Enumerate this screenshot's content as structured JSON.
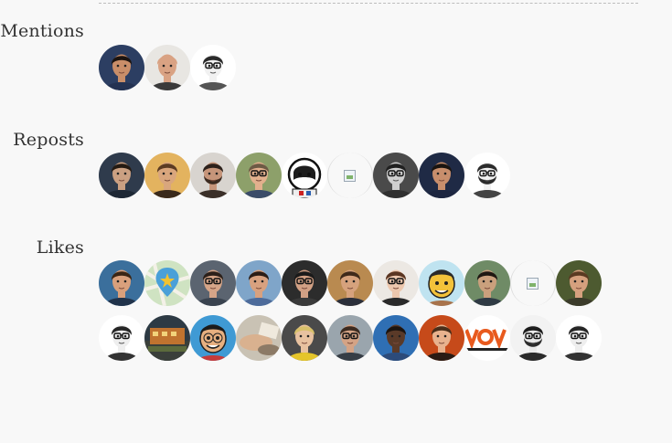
{
  "sections": {
    "mentions": {
      "label": "Mentions",
      "avatars": [
        {
          "icon": "person-avatar",
          "bg": "#2c3e62",
          "skin": "#c98e69",
          "hair": "#1c1410",
          "shirt": "#243252"
        },
        {
          "icon": "person-avatar",
          "bg": "#e8e6e2",
          "skin": "#d9a283",
          "hair": "#d9a283",
          "shirt": "#3a3a3a"
        },
        {
          "icon": "person-avatar",
          "bg": "#ffffff",
          "skin": "#f1f1f1",
          "hair": "#2a2a2a",
          "shirt": "#555555",
          "glasses": true,
          "mono": true
        }
      ]
    },
    "reposts": {
      "label": "Reposts",
      "avatars": [
        {
          "icon": "person-avatar",
          "bg": "#2f3b4c",
          "skin": "#cba082",
          "hair": "#241a12",
          "shirt": "#1e2835"
        },
        {
          "icon": "person-avatar",
          "bg": "#e3b35f",
          "skin": "#d9a67d",
          "hair": "#5b3b22",
          "shirt": "#3a2a1c"
        },
        {
          "icon": "person-avatar",
          "bg": "#d8d4cf",
          "skin": "#c6957a",
          "hair": "#2c211b",
          "shirt": "#3a2f28",
          "beard": "#3b2a20"
        },
        {
          "icon": "person-avatar",
          "bg": "#8da06a",
          "skin": "#e2b08d",
          "hair": "#6d5a45",
          "shirt": "#3b4c69",
          "glasses": true
        },
        {
          "icon": "astronaut-icon",
          "bg": "#ffffff",
          "skin": "#ffffff",
          "hair": "#1d1d1d",
          "shirt": "#cc2222"
        },
        {
          "icon": "broken-image-icon",
          "broken": true
        },
        {
          "icon": "person-avatar",
          "bg": "#4a4a4a",
          "skin": "#cfcfcf",
          "hair": "#202020",
          "shirt": "#303030",
          "glasses": true,
          "mono": true
        },
        {
          "icon": "person-avatar",
          "bg": "#1f2a45",
          "skin": "#c88e6c",
          "hair": "#1a1410",
          "shirt": "#1d2640"
        },
        {
          "icon": "person-avatar",
          "bg": "#ffffff",
          "skin": "#f2f2f2",
          "hair": "#2b2b2b",
          "shirt": "#444444",
          "beard": "#2b2b2b",
          "glasses": true,
          "mono": true
        }
      ]
    },
    "likes": {
      "label": "Likes",
      "avatars": [
        {
          "icon": "person-avatar",
          "bg": "#3b6f9c",
          "skin": "#d9a07c",
          "hair": "#3a2514",
          "shirt": "#20324a"
        },
        {
          "icon": "map-pin-icon",
          "bg": "#cfe3c2",
          "skin": "#4aa0d8",
          "hair": "#f2c230",
          "shirt": "#d7d7d7"
        },
        {
          "icon": "person-avatar",
          "bg": "#5b6470",
          "skin": "#d6a588",
          "hair": "#2b201a",
          "shirt": "#3a434f",
          "glasses": true
        },
        {
          "icon": "person-avatar",
          "bg": "#7fa5c9",
          "skin": "#d8a17f",
          "hair": "#2b1d16",
          "shirt": "#4d6b9a"
        },
        {
          "icon": "person-avatar",
          "bg": "#2c2c2c",
          "skin": "#d2a084",
          "hair": "#1a1a1a",
          "shirt": "#3a3a3a",
          "glasses": true
        },
        {
          "icon": "person-avatar",
          "bg": "#b98a50",
          "skin": "#d6a27d",
          "hair": "#3f2a1a",
          "shirt": "#2b2f3a"
        },
        {
          "icon": "person-avatar",
          "bg": "#ece8e3",
          "skin": "#edc7ad",
          "hair": "#5a3521",
          "shirt": "#2a2a2a",
          "glasses": true
        },
        {
          "icon": "cartoon-avatar",
          "bg": "#bfe3f0",
          "skin": "#f3c23a",
          "hair": "#2a2a2a",
          "shirt": "#a8734b"
        },
        {
          "icon": "person-avatar",
          "bg": "#6f8b66",
          "skin": "#caa07d",
          "hair": "#1f1812",
          "shirt": "#2f3a44"
        },
        {
          "icon": "broken-image-icon",
          "broken": true
        },
        {
          "icon": "person-avatar",
          "bg": "#4d5a30",
          "skin": "#d5a07e",
          "hair": "#5a3a22",
          "shirt": "#3b3b2a"
        },
        {
          "icon": "person-avatar",
          "bg": "#ffffff",
          "skin": "#eeeeee",
          "hair": "#262626",
          "shirt": "#333333",
          "glasses": true,
          "mono": true
        },
        {
          "icon": "street-scene-icon",
          "bg": "#2d3a44",
          "skin": "#c0732f",
          "hair": "#8a4b22",
          "shirt": "#5c6a3c"
        },
        {
          "icon": "cartoon-avatar",
          "bg": "#3f9ad4",
          "skin": "#e7b080",
          "hair": "#1b1b1b",
          "shirt": "#c53b3b",
          "glasses": true
        },
        {
          "icon": "hands-photo-icon",
          "bg": "#c9c2b4",
          "skin": "#d9b18f",
          "hair": "#8c7a66",
          "shirt": "#efe9dd"
        },
        {
          "icon": "person-avatar",
          "bg": "#4a4a4a",
          "skin": "#e8c2a0",
          "hair": "#d8c06a",
          "shirt": "#e5c52b"
        },
        {
          "icon": "person-avatar",
          "bg": "#9aa5ad",
          "skin": "#d4a385",
          "hair": "#3b2a20",
          "shirt": "#363d45",
          "glasses": true
        },
        {
          "icon": "person-avatar",
          "bg": "#2f6fb4",
          "skin": "#5a3a28",
          "hair": "#1b1410",
          "shirt": "#2c4b7a"
        },
        {
          "icon": "person-avatar",
          "bg": "#c64a1a",
          "skin": "#e8b28e",
          "hair": "#4a2e1a",
          "shirt": "#2a1b14"
        },
        {
          "icon": "conference-logo-icon",
          "bg": "#ffffff",
          "skin": "#e85a1e",
          "hair": "#222222",
          "shirt": "#e85a1e"
        },
        {
          "icon": "person-avatar",
          "bg": "#f2f2f2",
          "skin": "#e8e8e8",
          "hair": "#1c1c1c",
          "shirt": "#2a2a2a",
          "beard": "#2b2b2b",
          "glasses": true,
          "mono": true
        },
        {
          "icon": "person-avatar",
          "bg": "#ffffff",
          "skin": "#eeeeee",
          "hair": "#262626",
          "shirt": "#333333",
          "glasses": true,
          "mono": true
        }
      ]
    }
  }
}
